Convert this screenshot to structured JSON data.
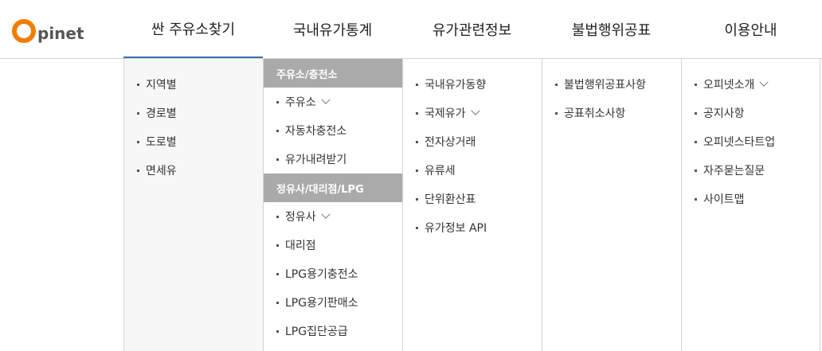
{
  "logo": {
    "mark": "O",
    "text": "pinet"
  },
  "nav": [
    {
      "label": "싼 주유소찾기"
    },
    {
      "label": "국내유가통계"
    },
    {
      "label": "유가관련정보"
    },
    {
      "label": "불법행위공표"
    },
    {
      "label": "이용안내"
    }
  ],
  "menu": {
    "col1": {
      "items": [
        "지역별",
        "경로별",
        "도로별",
        "면세유"
      ]
    },
    "col2": {
      "group1_title": "주유소/충전소",
      "group1": [
        "주유소",
        "자동차충전소",
        "유가내려받기"
      ],
      "group2_title": "정유사/대리점/LPG",
      "group2": [
        "정유사",
        "대리점",
        "LPG용기충전소",
        "LPG용기판매소",
        "LPG집단공급"
      ]
    },
    "col3": {
      "items": [
        "국내유가동향",
        "국제유가",
        "전자상거래",
        "유류세",
        "단위환산표",
        "유가정보 API"
      ]
    },
    "col4": {
      "items": [
        "불법행위공표사항",
        "공표취소사항"
      ]
    },
    "col5": {
      "items": [
        "오피넷소개",
        "공지사항",
        "오피넷스타트업",
        "자주묻는질문",
        "사이트맵"
      ]
    }
  }
}
